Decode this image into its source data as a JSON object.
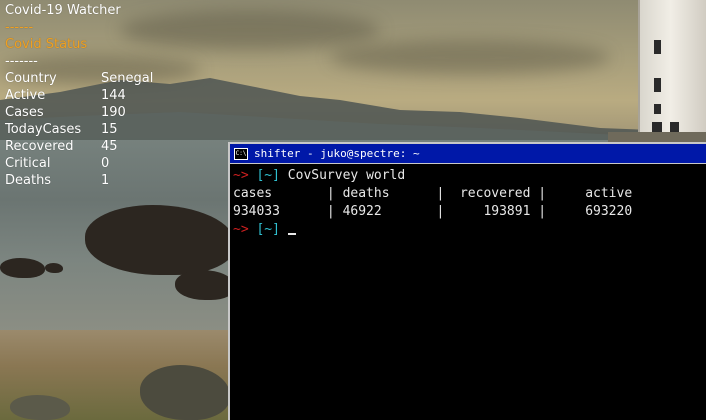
{
  "conky": {
    "title": "Covid-19  Watcher",
    "sep1": "------",
    "status_heading": "Covid  Status",
    "sep2": "-------",
    "rows": [
      {
        "label": "Country",
        "value": "Senegal"
      },
      {
        "label": "Active",
        "value": "144"
      },
      {
        "label": "Cases",
        "value": "190"
      },
      {
        "label": "TodayCases",
        "value": "15"
      },
      {
        "label": "Recovered",
        "value": "45"
      },
      {
        "label": "Critical",
        "value": "0"
      },
      {
        "label": "Deaths",
        "value": "1"
      }
    ]
  },
  "terminal": {
    "icon_text": "C:\\",
    "title": "shifter - juko@spectre: ~",
    "prompt_arrow": "~>",
    "prompt_dir": "[~]",
    "command": "CovSurvey world",
    "table_header": "cases       | deaths      |  recovered |     active",
    "table_row": "934033      | 46922       |     193891 |     693220"
  },
  "colors": {
    "titlebar": "#0018a8",
    "prompt_arrow": "#d02020",
    "prompt_dir": "#30c0d0",
    "conky_accent": "#f0a020"
  }
}
